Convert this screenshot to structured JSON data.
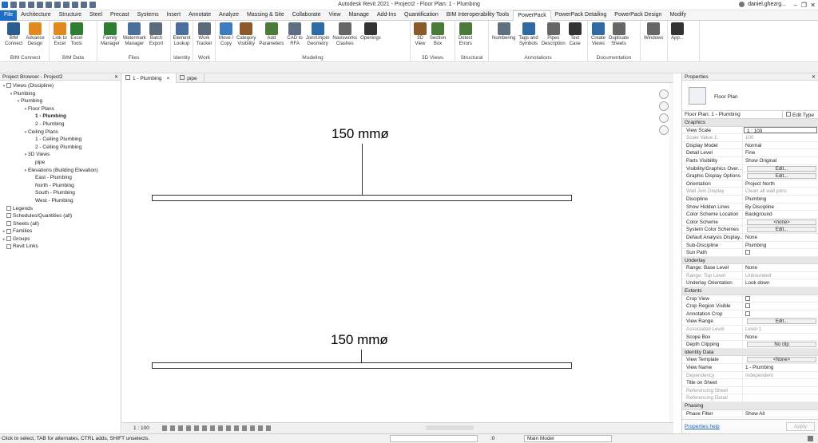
{
  "app_title": "Autodesk Revit 2021 - Project2 - Floor Plan: 1 - Plumbing",
  "user": "daniel.ghezrg...",
  "ribbon_tabs": [
    "File",
    "Architecture",
    "Structure",
    "Steel",
    "Precast",
    "Systems",
    "Insert",
    "Annotate",
    "Analyze",
    "Massing & Site",
    "Collaborate",
    "View",
    "Manage",
    "Add-Ins",
    "Quantification",
    "BIM Interoperability Tools",
    "PowerPack",
    "PowerPack Detailing",
    "PowerPack Design",
    "Modify"
  ],
  "ribbon_panels": [
    {
      "title": "BIM Connect",
      "buttons": [
        "BIM\nConnect",
        "Advance\nDesign"
      ]
    },
    {
      "title": "BIM Data",
      "buttons": [
        "Link to\nExcel",
        "Excel\nTools"
      ]
    },
    {
      "title": "Files",
      "buttons": [
        "Family\nManager",
        "Watermark\nManager",
        "Batch\nExport"
      ]
    },
    {
      "title": "Identity",
      "buttons": [
        "Element\nLookup"
      ]
    },
    {
      "title": "Work",
      "buttons": [
        "Work\nTracker"
      ]
    },
    {
      "title": "Modeling",
      "buttons": [
        "Move /\nCopy",
        "Category\nVisibility",
        "Add\nParameters",
        "CAD to\nRFA",
        "Join/Unjoin\nGeometry",
        "Navisworks\nClashes",
        "Openings"
      ]
    },
    {
      "title": "3D Views",
      "buttons": [
        "3D\nView",
        "Section\nBox"
      ]
    },
    {
      "title": "Structural",
      "buttons": [
        "Detect\nErrors"
      ]
    },
    {
      "title": "Annotations",
      "buttons": [
        "Numbering",
        "Tags and\nSymbols",
        "Pipes\nDescription",
        "Text\nCase"
      ]
    },
    {
      "title": "Documentation",
      "buttons": [
        "Create\nViews",
        "Duplicate\nSheets"
      ]
    },
    {
      "title": "",
      "buttons": [
        "Windows"
      ]
    },
    {
      "title": "",
      "buttons": [
        "App..."
      ]
    }
  ],
  "project_browser": {
    "title": "Project Browser - Project2",
    "nodes": [
      {
        "label": "Views (Discipline)",
        "level": 0,
        "toggle": "-"
      },
      {
        "label": "Plumbing",
        "level": 1,
        "toggle": "-"
      },
      {
        "label": "Plumbing",
        "level": 2,
        "toggle": "-"
      },
      {
        "label": "Floor Plans",
        "level": 3,
        "toggle": "-"
      },
      {
        "label": "1 - Plumbing",
        "level": 4,
        "toggle": "",
        "selected": true
      },
      {
        "label": "2 - Plumbing",
        "level": 4,
        "toggle": ""
      },
      {
        "label": "Ceiling Plans",
        "level": 3,
        "toggle": "-"
      },
      {
        "label": "1 - Ceiling Plumbing",
        "level": 4,
        "toggle": ""
      },
      {
        "label": "2 - Ceiling Plumbing",
        "level": 4,
        "toggle": ""
      },
      {
        "label": "3D Views",
        "level": 3,
        "toggle": "-"
      },
      {
        "label": "pipe",
        "level": 4,
        "toggle": ""
      },
      {
        "label": "Elevations (Building Elevation)",
        "level": 3,
        "toggle": "-"
      },
      {
        "label": "East - Plumbing",
        "level": 4,
        "toggle": ""
      },
      {
        "label": "North - Plumbing",
        "level": 4,
        "toggle": ""
      },
      {
        "label": "South - Plumbing",
        "level": 4,
        "toggle": ""
      },
      {
        "label": "West - Plumbing",
        "level": 4,
        "toggle": ""
      },
      {
        "label": "Legends",
        "level": 0,
        "toggle": ""
      },
      {
        "label": "Schedules/Quantities (all)",
        "level": 0,
        "toggle": ""
      },
      {
        "label": "Sheets (all)",
        "level": 0,
        "toggle": ""
      },
      {
        "label": "Families",
        "level": 0,
        "toggle": "+"
      },
      {
        "label": "Groups",
        "level": 0,
        "toggle": "+"
      },
      {
        "label": "Revit Links",
        "level": 0,
        "toggle": ""
      }
    ]
  },
  "view_tabs": [
    {
      "label": "1 - Plumbing",
      "active": true,
      "close": "×"
    },
    {
      "label": "pipe",
      "active": false,
      "close": ""
    }
  ],
  "canvas": {
    "labels": [
      "150 mmø",
      "150 mmø"
    ]
  },
  "view_controls": {
    "scale": "1 : 100"
  },
  "properties": {
    "title": "Properties",
    "type_name": "Floor Plan",
    "instance_selector": "Floor Plan: 1 - Plumbing",
    "edit_type": "Edit Type",
    "rows": [
      {
        "cat": "Graphics"
      },
      {
        "k": "View Scale",
        "v": "1 : 100",
        "kind": "input"
      },
      {
        "k": "Scale Value    1:",
        "v": "100",
        "dis": true
      },
      {
        "k": "Display Model",
        "v": "Normal"
      },
      {
        "k": "Detail Level",
        "v": "Fine"
      },
      {
        "k": "Parts Visibility",
        "v": "Show Original"
      },
      {
        "k": "Visibility/Graphics Over...",
        "v": "Edit...",
        "kind": "btn"
      },
      {
        "k": "Graphic Display Options",
        "v": "Edit...",
        "kind": "btn"
      },
      {
        "k": "Orientation",
        "v": "Project North"
      },
      {
        "k": "Wall Join Display",
        "v": "Clean all wall joins",
        "dis": true
      },
      {
        "k": "Discipline",
        "v": "Plumbing"
      },
      {
        "k": "Show Hidden Lines",
        "v": "By Discipline"
      },
      {
        "k": "Color Scheme Location",
        "v": "Background"
      },
      {
        "k": "Color Scheme",
        "v": "<none>",
        "kind": "btn"
      },
      {
        "k": "System Color Schemes",
        "v": "Edit...",
        "kind": "btn"
      },
      {
        "k": "Default Analysis Display...",
        "v": "None"
      },
      {
        "k": "Sub-Discipline",
        "v": "Plumbing"
      },
      {
        "k": "Sun Path",
        "v": "",
        "kind": "cb"
      },
      {
        "cat": "Underlay"
      },
      {
        "k": "Range: Base Level",
        "v": "None"
      },
      {
        "k": "Range: Top Level",
        "v": "Unbounded",
        "dis": true
      },
      {
        "k": "Underlay Orientation",
        "v": "Look down"
      },
      {
        "cat": "Extents"
      },
      {
        "k": "Crop View",
        "v": "",
        "kind": "cb"
      },
      {
        "k": "Crop Region Visible",
        "v": "",
        "kind": "cb"
      },
      {
        "k": "Annotation Crop",
        "v": "",
        "kind": "cb"
      },
      {
        "k": "View Range",
        "v": "Edit...",
        "kind": "btn"
      },
      {
        "k": "Associated Level",
        "v": "Level 1",
        "dis": true
      },
      {
        "k": "Scope Box",
        "v": "None"
      },
      {
        "k": "Depth Clipping",
        "v": "No clip",
        "kind": "btn"
      },
      {
        "cat": "Identity Data"
      },
      {
        "k": "View Template",
        "v": "<None>",
        "kind": "btn"
      },
      {
        "k": "View Name",
        "v": "1 - Plumbing"
      },
      {
        "k": "Dependency",
        "v": "Independent",
        "dis": true
      },
      {
        "k": "Title on Sheet",
        "v": ""
      },
      {
        "k": "Referencing Sheet",
        "v": "",
        "dis": true
      },
      {
        "k": "Referencing Detail",
        "v": "",
        "dis": true
      },
      {
        "cat": "Phasing"
      },
      {
        "k": "Phase Filter",
        "v": "Show All"
      }
    ],
    "help": "Properties help",
    "apply": "Apply"
  },
  "status": {
    "message": "Click to select, TAB for alternates, CTRL adds, SHIFT unselects.",
    "zero": ":0",
    "model": "Main Model"
  },
  "colors": {
    "file_tab": "#1e6fc4",
    "accent": "#1e6fc4"
  }
}
